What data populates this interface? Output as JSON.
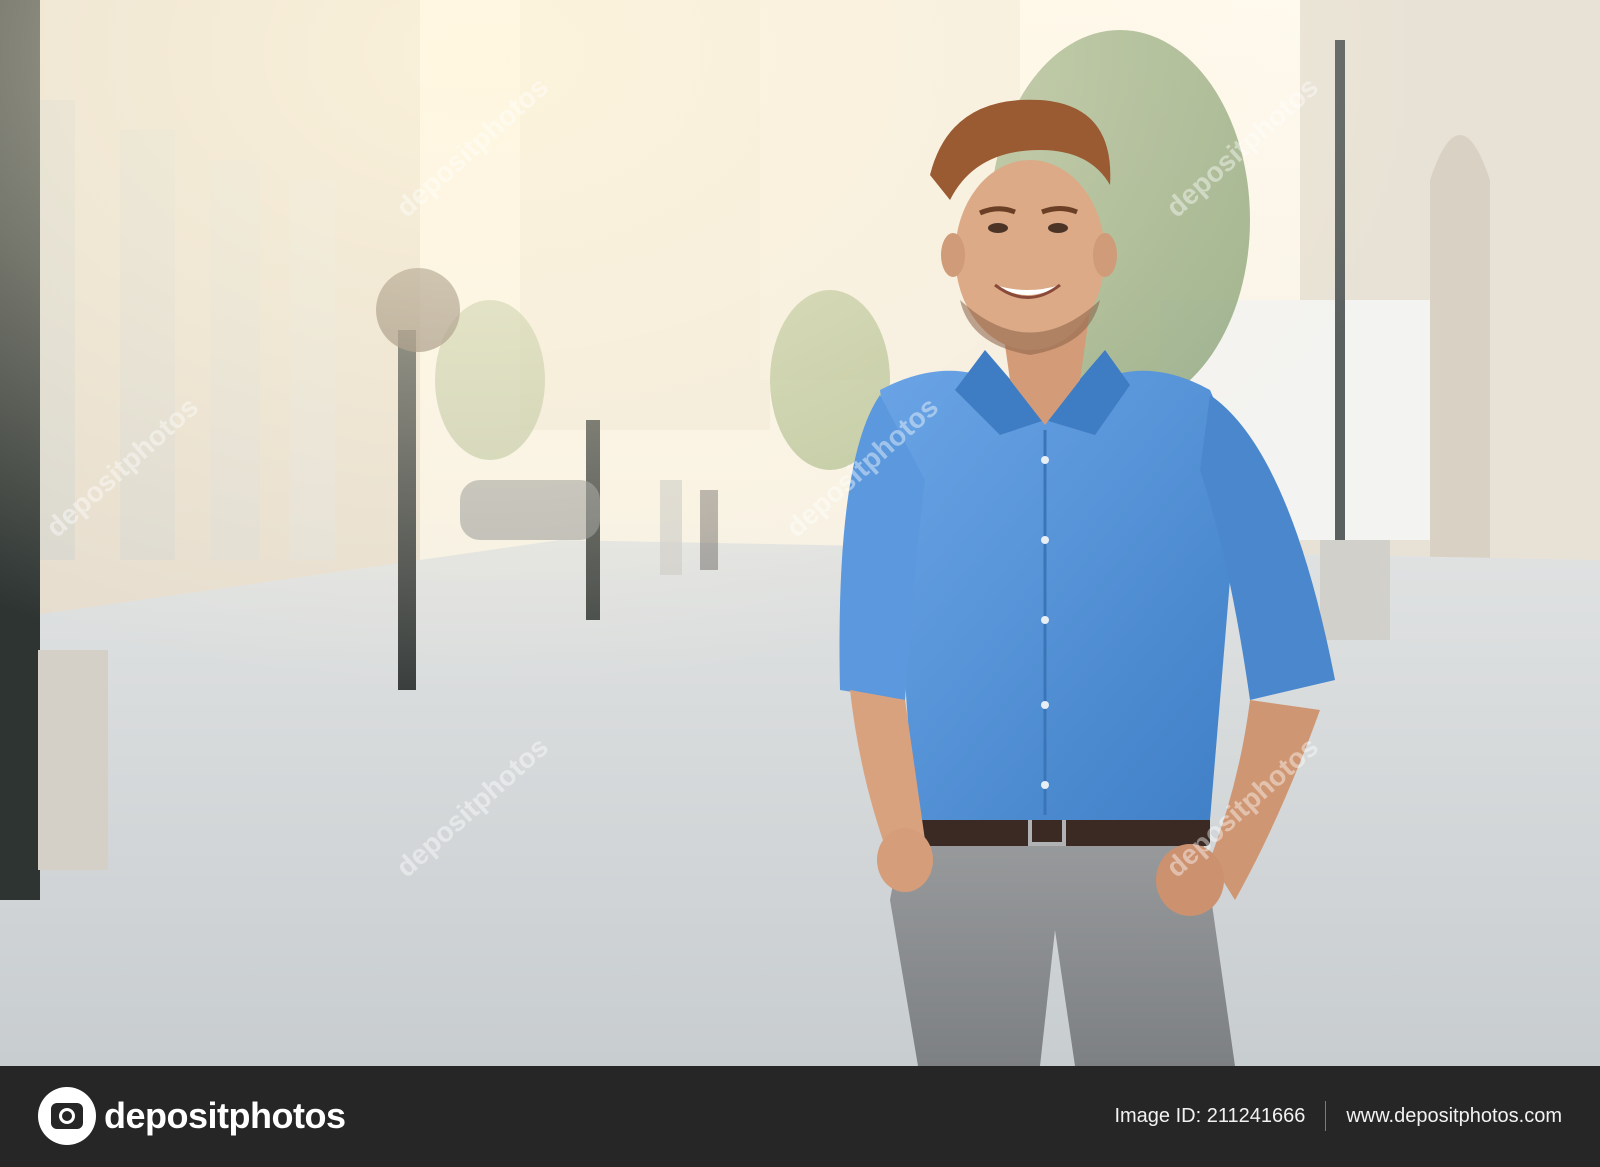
{
  "watermark": {
    "text": "depositphotos"
  },
  "footer": {
    "logo_text": "depositphotos",
    "image_id": "Image ID: 211241666",
    "url": "www.depositphotos.com"
  },
  "colors": {
    "shirt": "#4f8fd6",
    "footer_bg": "#262626",
    "street": "#cfd3d6",
    "sky": "#f7f0de"
  }
}
